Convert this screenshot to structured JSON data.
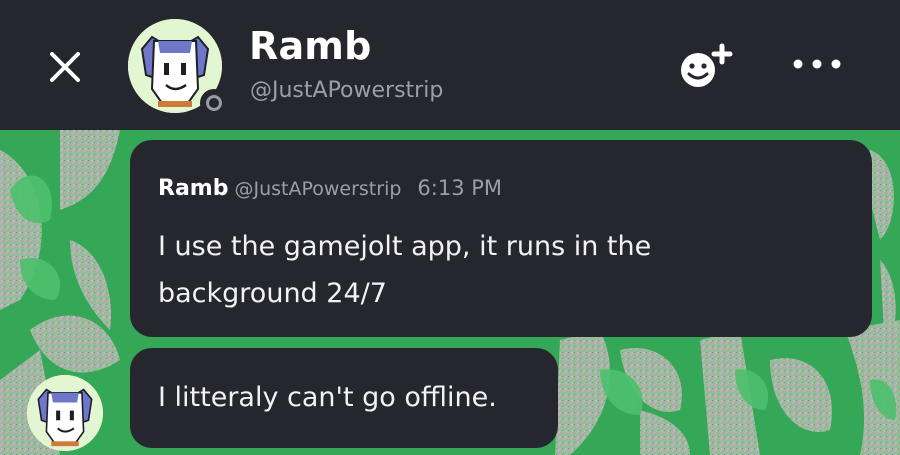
{
  "header": {
    "close_icon": "close-icon",
    "contact_name": "Ramb",
    "contact_handle": "@JustAPowerstrip",
    "status": "offline",
    "add_friend_icon": "add-friend-smiley-plus-icon",
    "more_icon": "more-horizontal-icon"
  },
  "messages": [
    {
      "author": "Ramb",
      "handle": "@JustAPowerstrip",
      "time": "6:13 PM",
      "text": "I use the gamejolt app, it runs in the background 24/7"
    },
    {
      "text": "I litteraly can't go offline."
    }
  ],
  "colors": {
    "header_bg": "#26262f",
    "bubble_bg": "#26262f",
    "background_green": "#3bb05f",
    "muted_text": "#9d9da6"
  }
}
